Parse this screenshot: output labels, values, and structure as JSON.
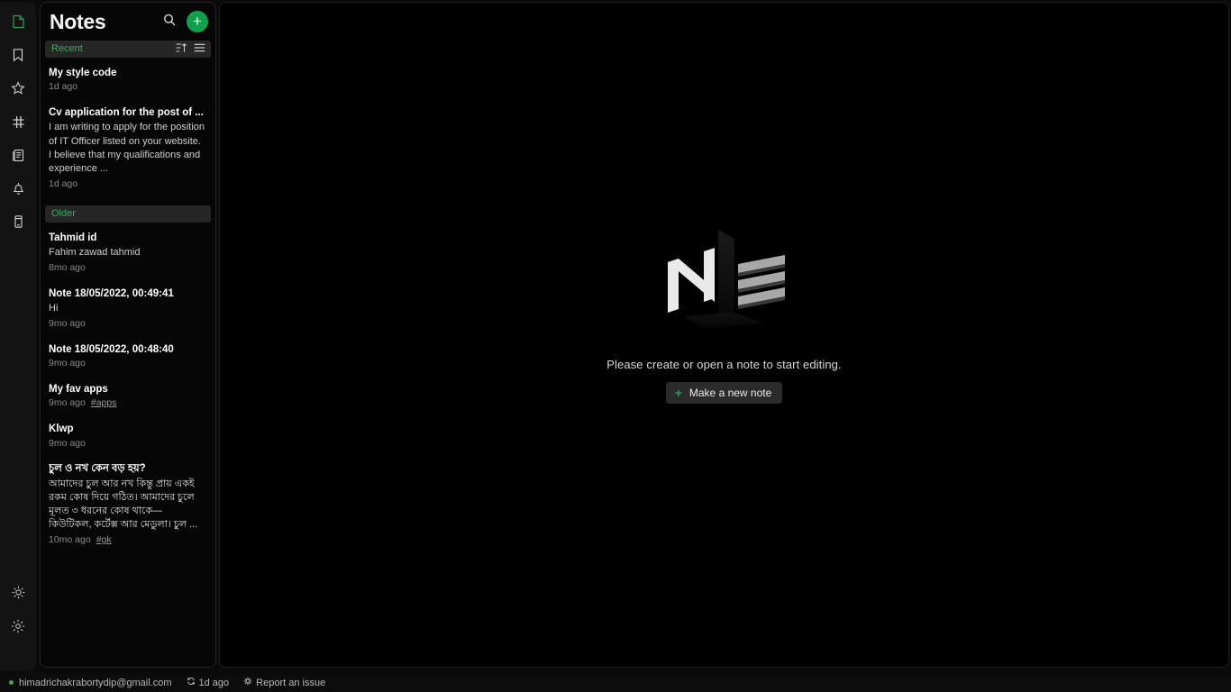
{
  "app": {
    "title": "Notes"
  },
  "rail": {
    "top_items": [
      {
        "name": "all-notes-icon",
        "label": "All notes",
        "active": true
      },
      {
        "name": "bookmark-icon",
        "label": "Bookmarks",
        "active": false
      },
      {
        "name": "star-icon",
        "label": "Favorites",
        "active": false
      },
      {
        "name": "hash-icon",
        "label": "Tags",
        "active": false
      },
      {
        "name": "notebooks-icon",
        "label": "Notebooks",
        "active": false
      },
      {
        "name": "bell-icon",
        "label": "Reminders",
        "active": false
      },
      {
        "name": "trash-icon",
        "label": "Trash",
        "active": false
      }
    ],
    "bottom_items": [
      {
        "name": "theme-toggle-icon",
        "label": "Theme"
      },
      {
        "name": "settings-gear-icon",
        "label": "Settings"
      }
    ]
  },
  "toolbar": {
    "search_label": "Search",
    "add_note_label": "+"
  },
  "sections": [
    {
      "label": "Recent",
      "sort_label": "Sort",
      "view_label": "View",
      "notes": [
        {
          "title": "My style code",
          "preview": "",
          "time": "1d ago",
          "tag": ""
        },
        {
          "title": "Cv application for the post of ...",
          "preview": "I am writing to apply for the position of IT Officer listed on your website. I believe that my qualifications and experience ...",
          "time": "1d ago",
          "tag": ""
        }
      ]
    },
    {
      "label": "Older",
      "notes": [
        {
          "title": "Tahmid id",
          "preview": "Fahim zawad tahmid",
          "time": "8mo ago",
          "tag": ""
        },
        {
          "title": "Note 18/05/2022, 00:49:41",
          "preview": "Hi",
          "time": "9mo ago",
          "tag": ""
        },
        {
          "title": "Note 18/05/2022, 00:48:40",
          "preview": "",
          "time": "9mo ago",
          "tag": ""
        },
        {
          "title": "My fav apps",
          "preview": "",
          "time": "9mo ago",
          "tag": "#apps"
        },
        {
          "title": "Klwp",
          "preview": "",
          "time": "9mo ago",
          "tag": ""
        },
        {
          "title": "চুল ও নখ কেন বড় হয়?",
          "preview": "আমাদের চুল আর নখ কিন্তু প্রায় একই রকম কোষ দিয়ে গঠিত। আমাদের চুলে মূলত ৩ ধরনের কোষ থাকে— কিউটিকল, কর্টেক্স আর মেডুলা।  চুল ...",
          "time": "10mo ago",
          "tag": "#gk"
        }
      ]
    }
  ],
  "editor": {
    "empty_message": "Please create or open a note to start editing.",
    "new_note_button": "Make a new note",
    "new_note_plus": "+",
    "logo_letter": "N"
  },
  "statusbar": {
    "account": "himadrichakrabortydip@gmail.com",
    "sync_time": "1d ago",
    "report_issue": "Report an issue"
  },
  "colors": {
    "accent_green": "#11a14a",
    "section_label_green": "#3fa95f",
    "panel_bg": "#060606",
    "rail_bg": "#131313"
  }
}
